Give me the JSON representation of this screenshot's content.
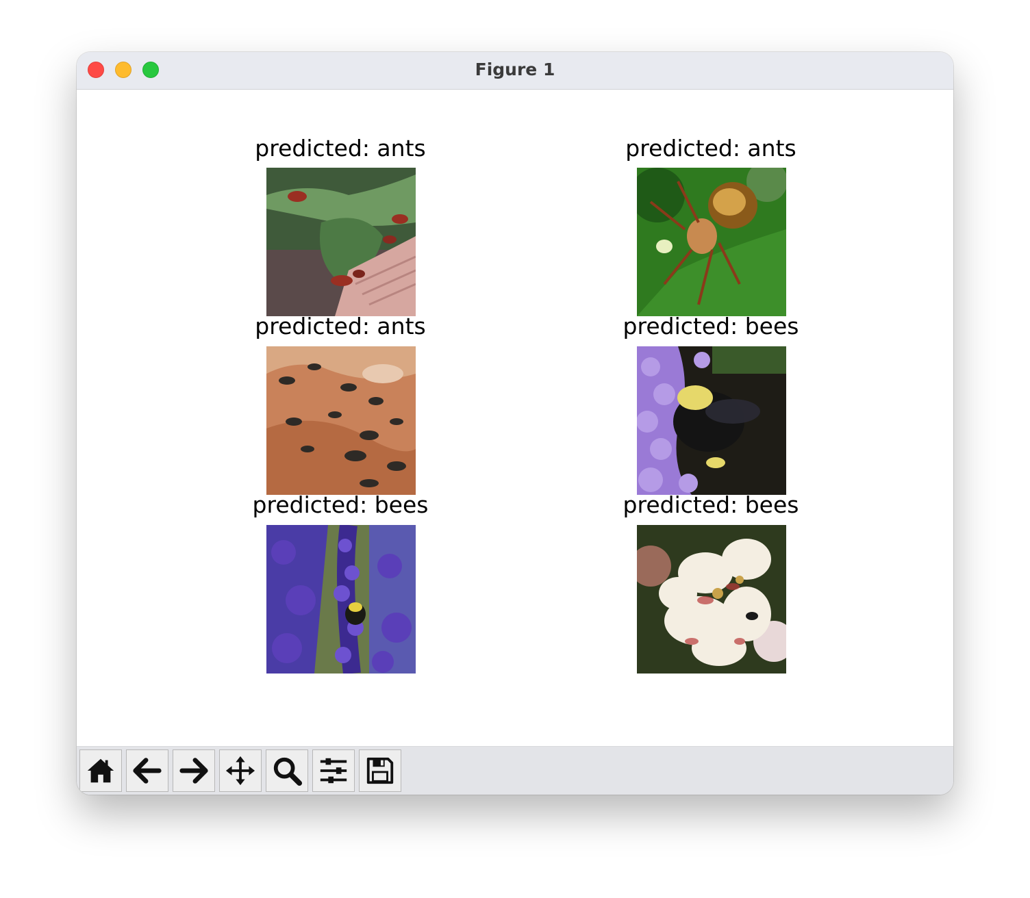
{
  "window": {
    "title": "Figure 1",
    "traffic_lights": {
      "close": "#fe4a46",
      "minimize": "#febb2e",
      "zoom": "#28c83f"
    }
  },
  "figure": {
    "panels": [
      {
        "title": "predicted: ants",
        "image": "leafcutter ants on a leaf"
      },
      {
        "title": "predicted: ants",
        "image": "ant on a green leaf"
      },
      {
        "title": "predicted: ants",
        "image": "ants on orange soil"
      },
      {
        "title": "predicted: bees",
        "image": "bumblebee on purple flowers"
      },
      {
        "title": "predicted: bees",
        "image": "bee on lavender"
      },
      {
        "title": "predicted: bees",
        "image": "insect on white blossom"
      }
    ]
  },
  "toolbar": {
    "buttons": [
      {
        "name": "home",
        "icon": "home-icon"
      },
      {
        "name": "back",
        "icon": "arrow-left-icon"
      },
      {
        "name": "forward",
        "icon": "arrow-right-icon"
      },
      {
        "name": "pan",
        "icon": "move-arrows-icon"
      },
      {
        "name": "zoom",
        "icon": "magnifier-icon"
      },
      {
        "name": "configure-subplots",
        "icon": "sliders-icon"
      },
      {
        "name": "save",
        "icon": "floppy-disk-icon"
      }
    ]
  }
}
